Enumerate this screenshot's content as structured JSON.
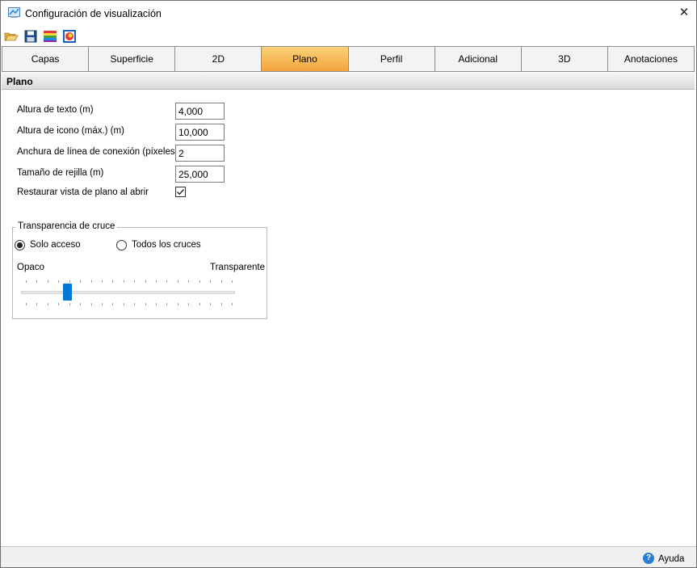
{
  "window": {
    "title": "Configuración de visualización",
    "close_label": "✕"
  },
  "toolbar": {
    "buttons": [
      {
        "icon": "open-folder-icon"
      },
      {
        "icon": "save-icon"
      },
      {
        "icon": "color-palette-icon"
      },
      {
        "icon": "color-settings-icon"
      }
    ]
  },
  "tabs": [
    {
      "label": "Capas",
      "active": false
    },
    {
      "label": "Superficie",
      "active": false
    },
    {
      "label": "2D",
      "active": false
    },
    {
      "label": "Plano",
      "active": true
    },
    {
      "label": "Perfil",
      "active": false
    },
    {
      "label": "Adicional",
      "active": false
    },
    {
      "label": "3D",
      "active": false
    },
    {
      "label": "Anotaciones",
      "active": false
    }
  ],
  "section": {
    "title": "Plano"
  },
  "fields": [
    {
      "label": "Altura de texto (m)",
      "value": "4,000"
    },
    {
      "label": "Altura de icono (máx.) (m)",
      "value": "10,000"
    },
    {
      "label": "Anchura de línea de conexión (píxeles)",
      "value": "2"
    },
    {
      "label": "Tamaño de rejilla (m)",
      "value": "25,000"
    }
  ],
  "restore_view": {
    "label": "Restaurar vista de plano al abrir",
    "checked": true
  },
  "crossing_transparency": {
    "legend": "Transparencia de cruce",
    "options": [
      {
        "label": "Solo acceso",
        "selected": true
      },
      {
        "label": "Todos los cruces",
        "selected": false
      }
    ],
    "slider": {
      "min_label": "Opaco",
      "max_label": "Transparente",
      "value_fraction": 0.2
    }
  },
  "footer": {
    "help_label": "Ayuda"
  },
  "colors": {
    "active_tab_top": "#fbd17a",
    "active_tab_bottom": "#f3a43c",
    "slider_thumb": "#0078d7",
    "help_icon": "#2b7cd3"
  }
}
